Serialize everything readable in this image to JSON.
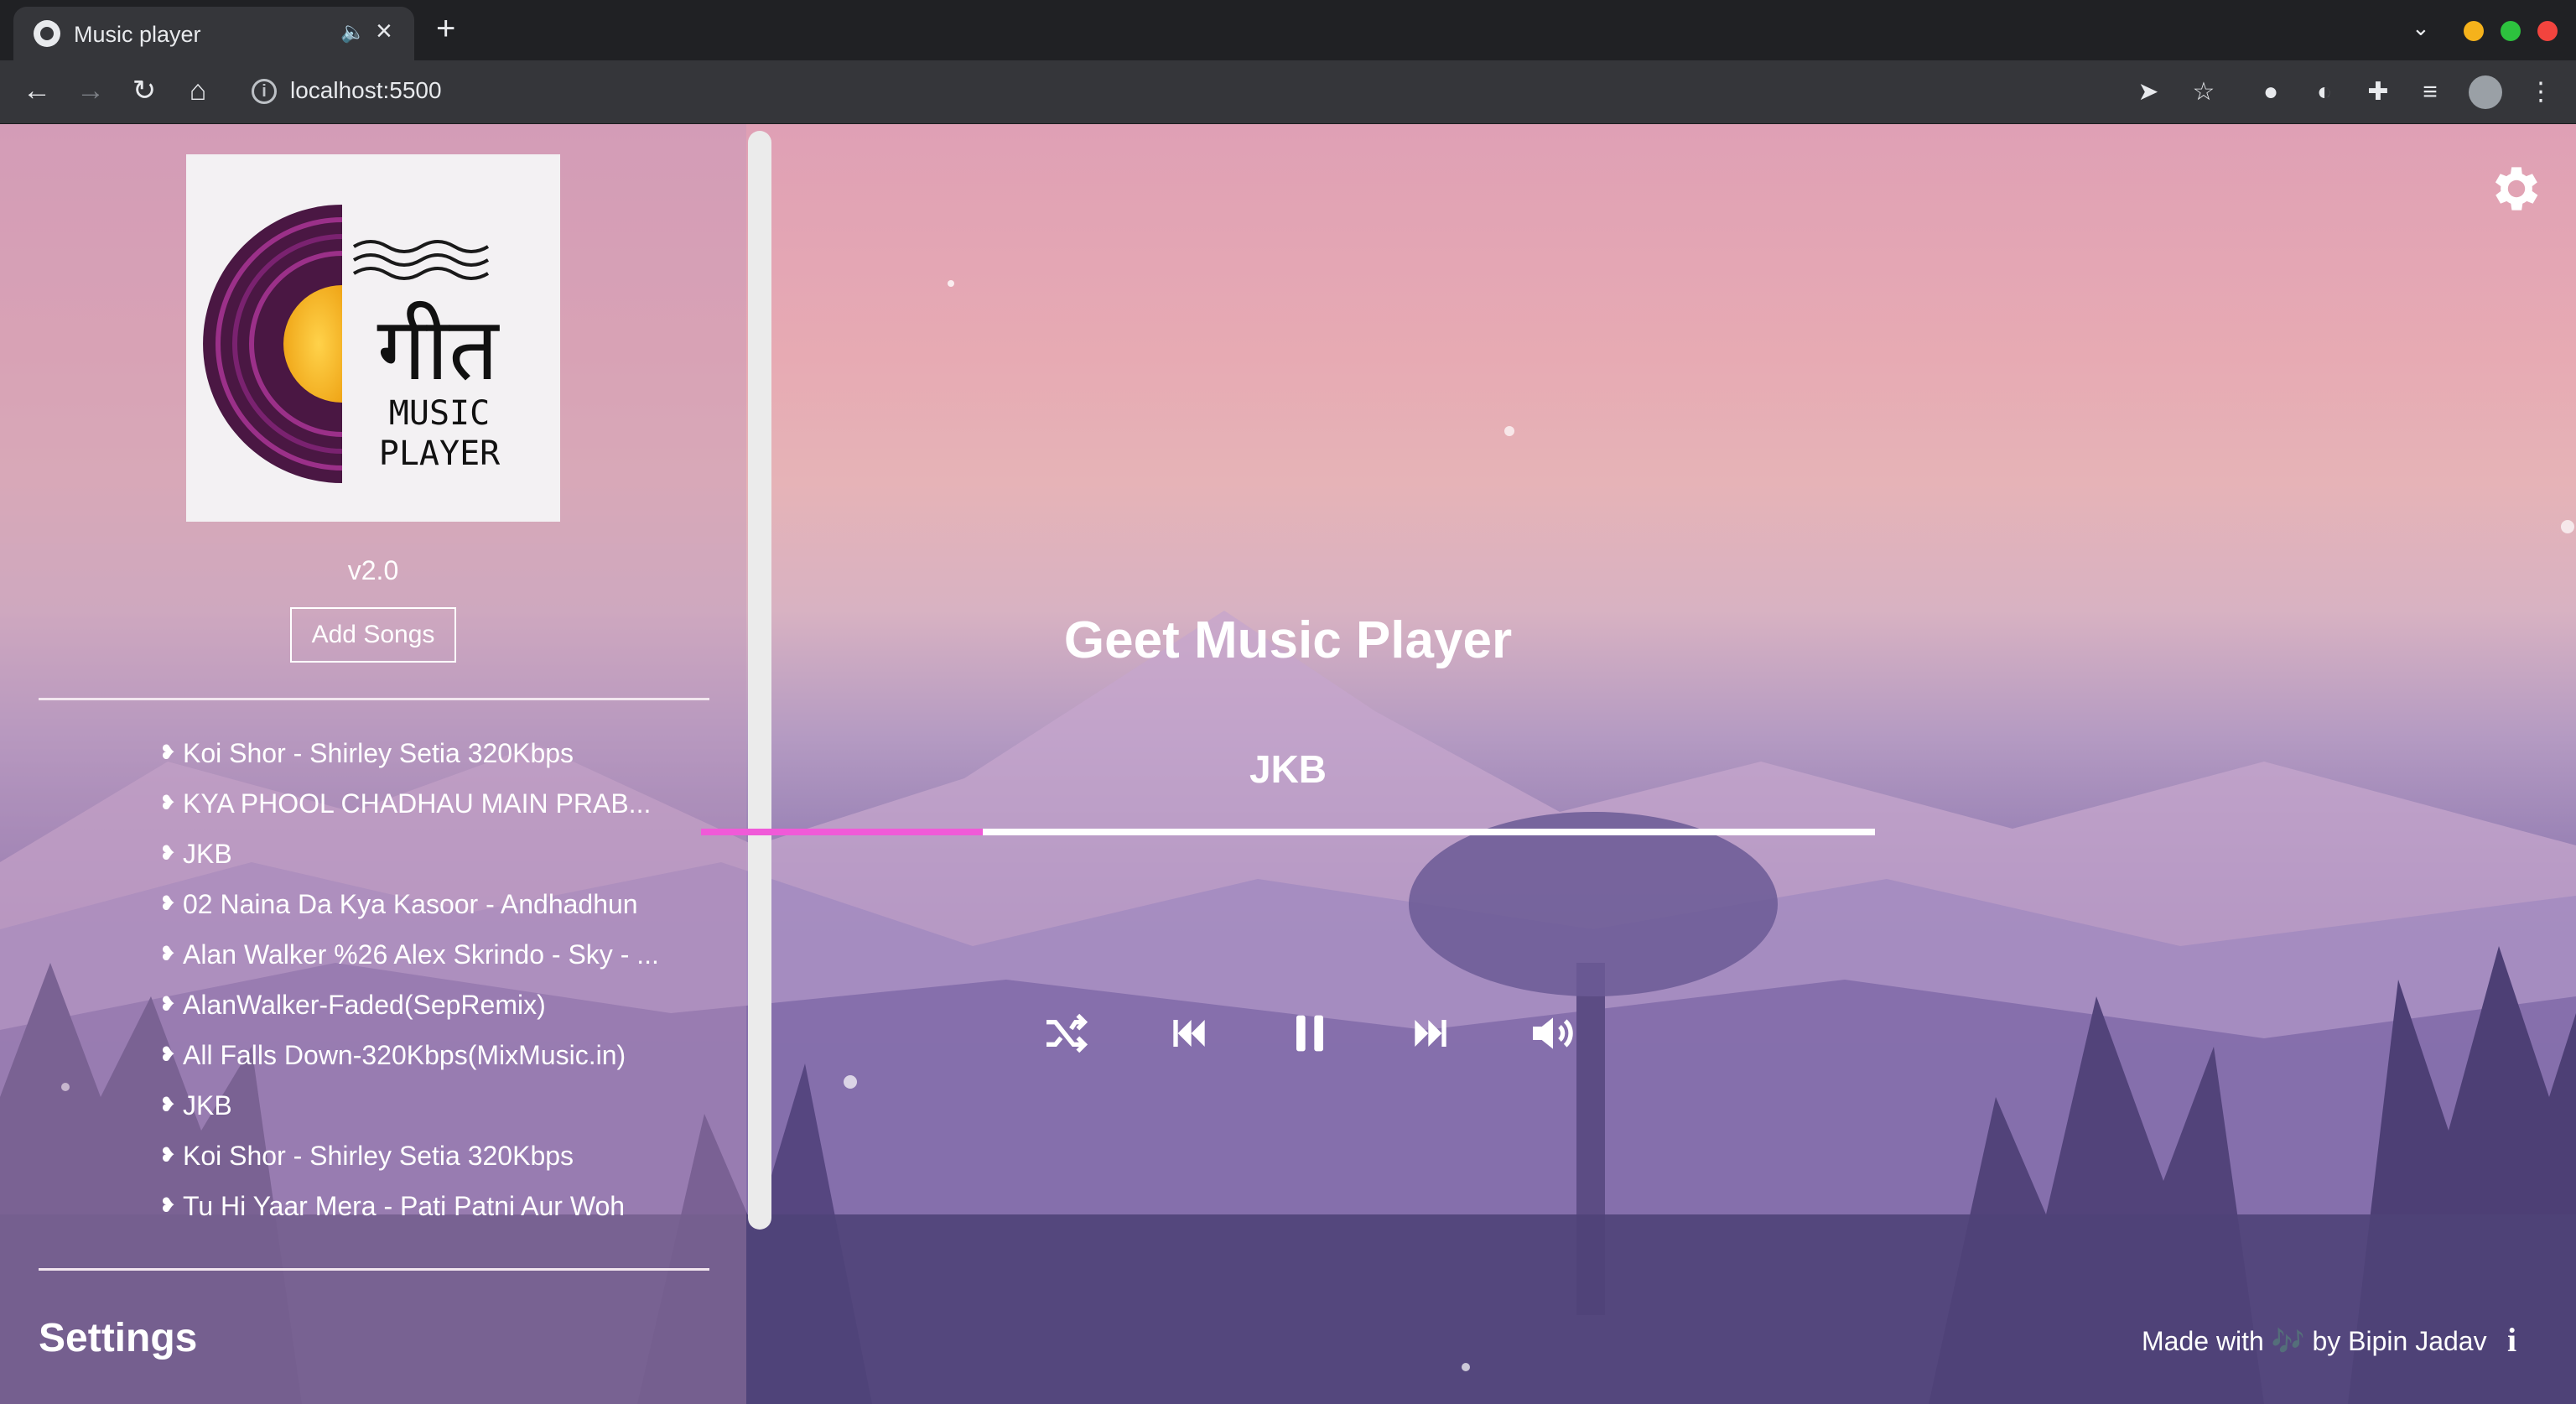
{
  "browser": {
    "tab_title": "Music player",
    "tab_audio_icon": "speaker-icon",
    "url": "localhost:5500",
    "window_dots": [
      "#f5b21b",
      "#2dc23e",
      "#f2443e"
    ]
  },
  "sidebar": {
    "logo": {
      "script_text": "गीत",
      "line1": "MUSIC",
      "line2": "PLAYER"
    },
    "version": "v2.0",
    "add_songs_label": "Add Songs",
    "songs": [
      "Koi Shor - Shirley Setia 320Kbps",
      "KYA PHOOL CHADHAU MAIN PRAB...",
      "JKB",
      "02 Naina Da Kya Kasoor - Andhadhun",
      "Alan Walker %26 Alex Skrindo - Sky - ...",
      "AlanWalker-Faded(SepRemix)",
      "All Falls Down-320Kbps(MixMusic.in)",
      "JKB",
      "Koi Shor - Shirley Setia 320Kbps",
      "Tu Hi Yaar Mera - Pati Patni Aur Woh"
    ],
    "settings_heading": "Settings"
  },
  "player": {
    "title": "Geet Music Player",
    "now_playing": "JKB",
    "progress": 0.24,
    "accent": "#f05ad8",
    "controls": [
      "shuffle-icon",
      "previous-icon",
      "pause-icon",
      "next-icon",
      "volume-icon"
    ]
  },
  "footer": {
    "made_with_prefix": "Made with",
    "made_with_icon": "🎶",
    "made_with_suffix": "by Bipin Jadav",
    "info_label": "i"
  }
}
